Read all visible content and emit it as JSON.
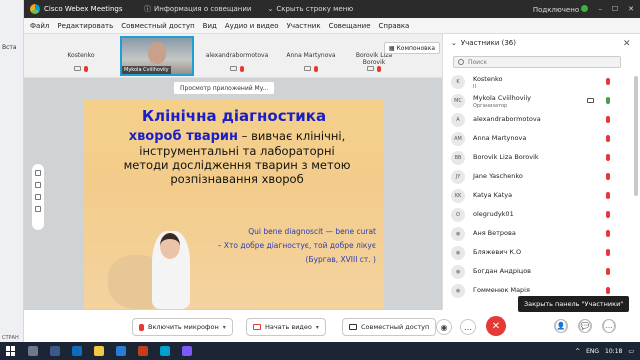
{
  "office": {
    "left_label": "Вста"
  },
  "titlebar": {
    "app_name": "Cisco Webex Meetings",
    "info": "Информация о совещании",
    "hide_bar": "Скрыть строку меню",
    "status": "Подключено"
  },
  "menu": [
    "Файл",
    "Редактировать",
    "Совместный доступ",
    "Вид",
    "Аудио и видео",
    "Участник",
    "Совещание",
    "Справка"
  ],
  "video_strip": {
    "tiles": [
      {
        "name": "Kostenko"
      },
      {
        "name": "alexandrabormotova"
      },
      {
        "name": "Anna Martynova"
      },
      {
        "name": "Borovik Liza Borovik"
      }
    ],
    "active_tag": "Mykola Cviilhoviiy",
    "compact_label": "Компоновка"
  },
  "stage": {
    "share_label": "Просмотр приложений My...",
    "slide": {
      "title": "Клінічна діагностика",
      "body_highlight": "хвороб тварин",
      "body_rest_1": " – вивчає клінічні,",
      "body_line_2": "інструментальні та лабораторні",
      "body_line_3": "методи дослідження тварин з метою",
      "body_line_4": "розпізнавання хвороб",
      "quote_1": "Qui bene diagnoscit — bene curat",
      "quote_2": "– Хто добре діагностує, той добре лікує",
      "quote_3": "(Бургав, XVIII ст. )"
    }
  },
  "controls": {
    "mic": "Включить микрофон",
    "video": "Начать видео",
    "share": "Совместный доступ"
  },
  "panel": {
    "title": "Участники (36)",
    "search_placeholder": "Поиск",
    "participants": [
      {
        "initials": "K",
        "name": "Kostenko",
        "sub": "II",
        "mic": "off"
      },
      {
        "initials": "MC",
        "name": "Mykola Cviilhoviiy",
        "sub": "Организатор",
        "mic": "on"
      },
      {
        "initials": "A",
        "name": "alexandrabormotova",
        "sub": "",
        "mic": "off"
      },
      {
        "initials": "AM",
        "name": "Anna Martynova",
        "sub": "",
        "mic": "off"
      },
      {
        "initials": "BB",
        "name": "Borovik Liza Borovik",
        "sub": "",
        "mic": "off"
      },
      {
        "initials": "JY",
        "name": "Jane Yaschenko",
        "sub": "",
        "mic": "off"
      },
      {
        "initials": "KK",
        "name": "Katya Katya",
        "sub": "",
        "mic": "off"
      },
      {
        "initials": "O",
        "name": "olegrudyk01",
        "sub": "",
        "mic": "off"
      },
      {
        "initials": "",
        "name": "Аня Ветрова",
        "sub": "",
        "mic": "off"
      },
      {
        "initials": "",
        "name": "Бляжевич К.О",
        "sub": "",
        "mic": "off"
      },
      {
        "initials": "",
        "name": "Богдан Андріцов",
        "sub": "",
        "mic": "off"
      },
      {
        "initials": "",
        "name": "Гомменюк Марія",
        "sub": "",
        "mic": "off"
      }
    ],
    "tooltip": "Закрыть панель \"Участники\""
  },
  "taskbar": {
    "lang": "ENG",
    "time": "10:18",
    "status_left": "СТРАН"
  }
}
